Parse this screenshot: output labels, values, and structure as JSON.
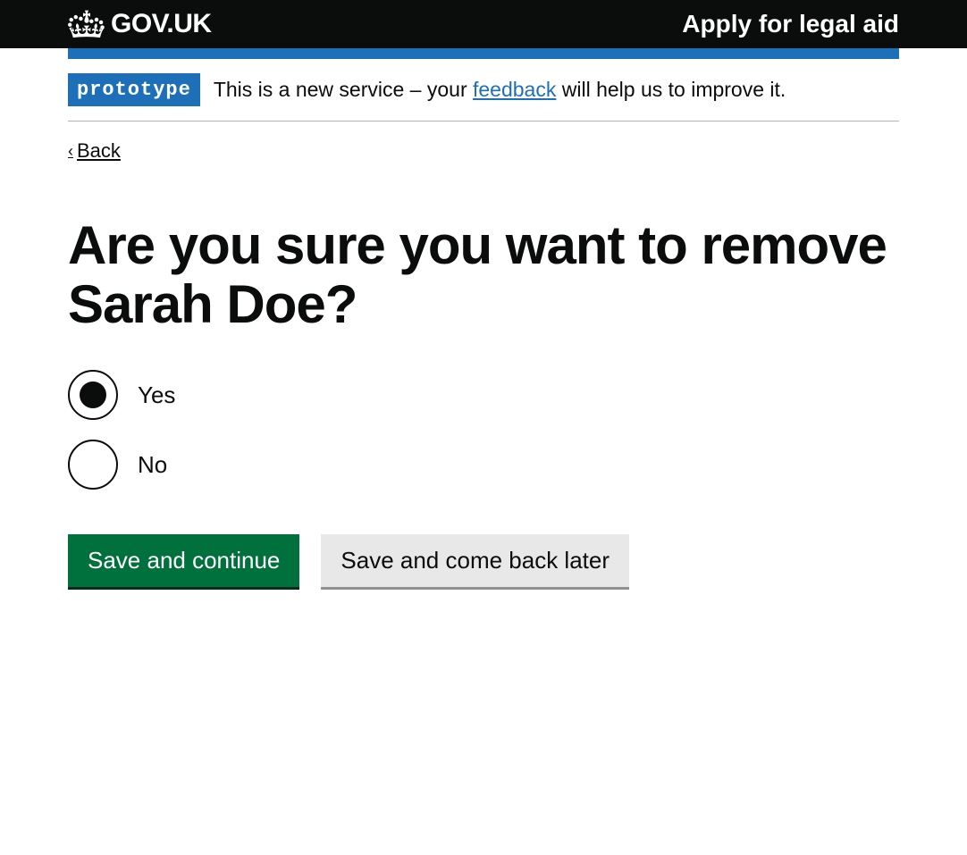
{
  "header": {
    "logo_text": "GOV.UK",
    "service_name": "Apply for legal aid"
  },
  "phase_banner": {
    "tag": "prototype",
    "text_before": "This is a new service – your ",
    "link_text": "feedback",
    "text_after": " will help us to improve it."
  },
  "back_link": "Back",
  "heading": "Are you sure you want to remove Sarah Doe?",
  "radios": {
    "options": [
      {
        "label": "Yes",
        "checked": true
      },
      {
        "label": "No",
        "checked": false
      }
    ]
  },
  "buttons": {
    "primary": "Save and continue",
    "secondary": "Save and come back later"
  }
}
